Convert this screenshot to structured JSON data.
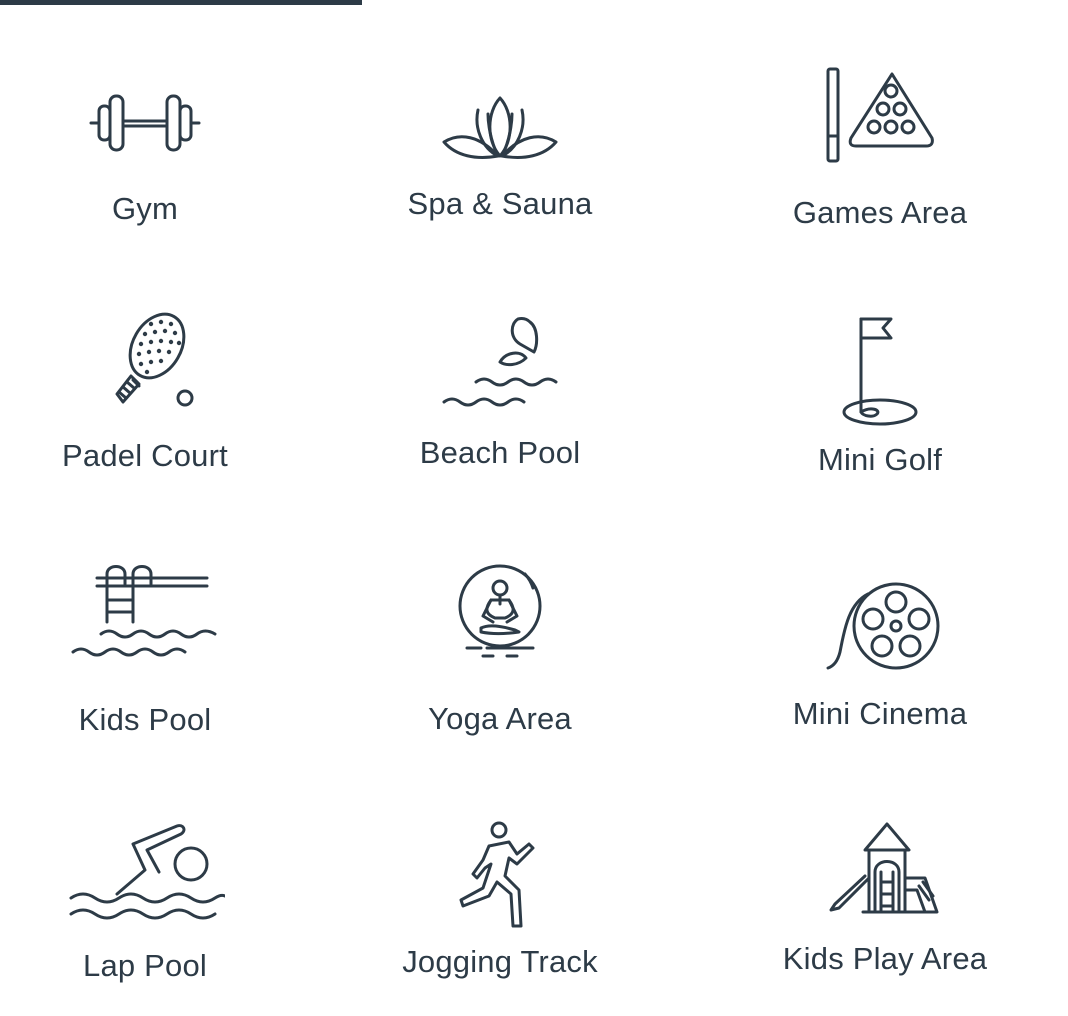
{
  "amenities": [
    {
      "label": "Gym",
      "icon": "dumbbell-icon"
    },
    {
      "label": "Spa & Sauna",
      "icon": "lotus-icon"
    },
    {
      "label": "Games Area",
      "icon": "billiards-icon"
    },
    {
      "label": "Padel Court",
      "icon": "padel-racket-icon"
    },
    {
      "label": "Beach Pool",
      "icon": "beach-pool-icon"
    },
    {
      "label": "Mini Golf",
      "icon": "golf-flag-icon"
    },
    {
      "label": "Kids Pool",
      "icon": "pool-ladder-icon"
    },
    {
      "label": "Yoga Area",
      "icon": "yoga-icon"
    },
    {
      "label": "Mini Cinema",
      "icon": "film-reel-icon"
    },
    {
      "label": "Lap Pool",
      "icon": "swimmer-icon"
    },
    {
      "label": "Jogging Track",
      "icon": "runner-icon"
    },
    {
      "label": "Kids Play Area",
      "icon": "playground-icon"
    }
  ],
  "colors": {
    "ink": "#2d3b47",
    "background": "#ffffff"
  }
}
